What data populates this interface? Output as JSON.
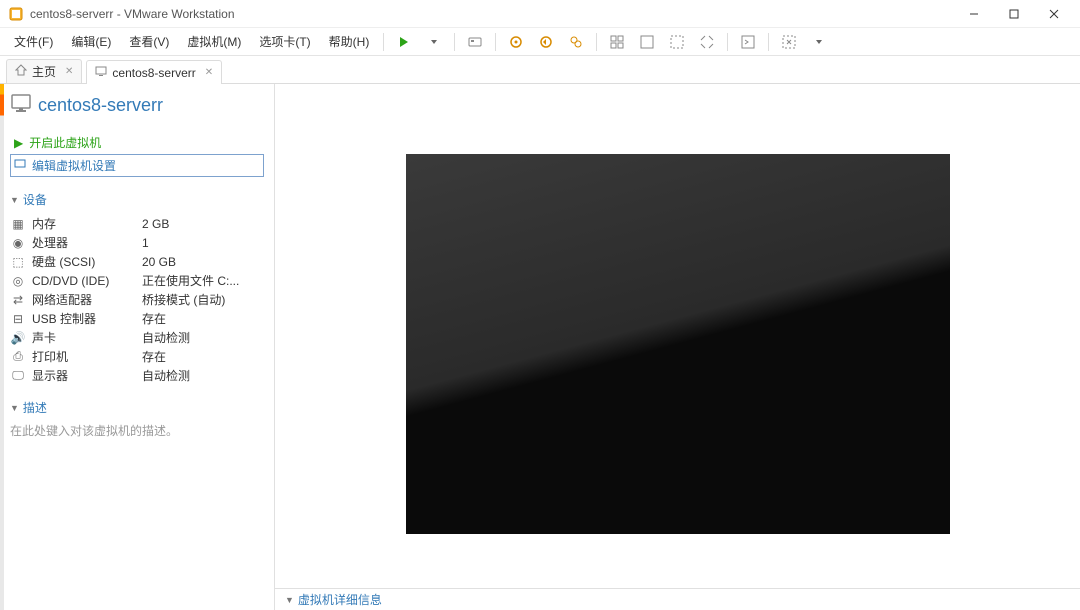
{
  "titlebar": {
    "title": "centos8-serverr - VMware Workstation"
  },
  "menubar": {
    "items": [
      "文件(F)",
      "编辑(E)",
      "查看(V)",
      "虚拟机(M)",
      "选项卡(T)",
      "帮助(H)"
    ]
  },
  "tabs": {
    "home": "主页",
    "vm": "centos8-serverr"
  },
  "vm": {
    "title": "centos8-serverr",
    "actions": {
      "power_on": "开启此虚拟机",
      "edit_settings": "编辑虚拟机设置"
    },
    "sections": {
      "devices": "设备",
      "description": "描述"
    },
    "devices": [
      {
        "name": "内存",
        "value": "2 GB",
        "icon": "memory"
      },
      {
        "name": "处理器",
        "value": "1",
        "icon": "cpu"
      },
      {
        "name": "硬盘 (SCSI)",
        "value": "20 GB",
        "icon": "disk"
      },
      {
        "name": "CD/DVD (IDE)",
        "value": "正在使用文件 C:...",
        "icon": "cd"
      },
      {
        "name": "网络适配器",
        "value": "桥接模式 (自动)",
        "icon": "network"
      },
      {
        "name": "USB 控制器",
        "value": "存在",
        "icon": "usb"
      },
      {
        "name": "声卡",
        "value": "自动检测",
        "icon": "sound"
      },
      {
        "name": "打印机",
        "value": "存在",
        "icon": "printer"
      },
      {
        "name": "显示器",
        "value": "自动检测",
        "icon": "display"
      }
    ],
    "description_placeholder": "在此处键入对该虚拟机的描述。"
  },
  "bottom": {
    "details": "虚拟机详细信息"
  }
}
